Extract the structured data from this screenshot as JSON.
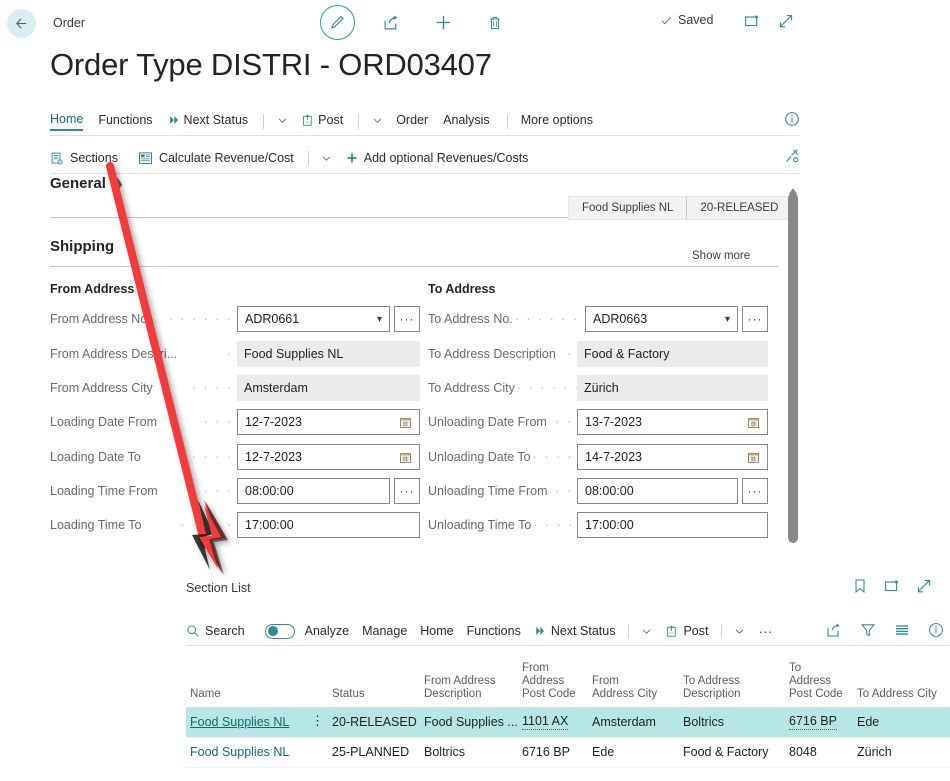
{
  "topbar": {
    "back_icon": "arrow-left-icon",
    "breadcrumb": "Order",
    "actions": [
      {
        "name": "edit-pencil-button",
        "icon": "pencil-icon"
      },
      {
        "name": "share-button",
        "icon": "share-icon"
      },
      {
        "name": "new-button",
        "icon": "plus-icon"
      },
      {
        "name": "delete-button",
        "icon": "trash-icon"
      }
    ],
    "saved_label": "Saved",
    "open-new-window-icon": "open-in-new-window-icon",
    "expand-icon": "expand-diagonal-icon"
  },
  "page_title": "Order Type DISTRI - ORD03407",
  "ribbon": {
    "items": [
      {
        "label": "Home",
        "active": true,
        "icon": null
      },
      {
        "label": "Functions",
        "active": false,
        "icon": null
      },
      {
        "label": "Next Status",
        "active": false,
        "icon": "double-chevron-right-icon"
      },
      {
        "label": "",
        "active": false,
        "icon": "chevron-down-icon"
      },
      {
        "label": "Post",
        "active": false,
        "icon": "post-document-icon"
      },
      {
        "label": "",
        "active": false,
        "icon": "chevron-down-icon"
      },
      {
        "label": "Order",
        "active": false,
        "icon": null
      },
      {
        "label": "Analysis",
        "active": false,
        "icon": null
      },
      {
        "label": "More options",
        "active": false,
        "icon": null
      }
    ],
    "info_icon": "info-circle-icon"
  },
  "actionbar": {
    "items": [
      {
        "label": "Sections",
        "icon": "sections-document-icon"
      },
      {
        "label": "Calculate Revenue/Cost",
        "icon": "calculate-document-icon"
      },
      {
        "label": "",
        "icon": "chevron-down-icon"
      },
      {
        "label": "Add optional Revenues/Costs",
        "icon": "plus-icon"
      }
    ],
    "pin_icon": "pin-unpin-icon"
  },
  "general": {
    "title": "General",
    "collapse_icon": "chevron-right-icon",
    "badges": [
      "Food Supplies NL",
      "20-RELEASED"
    ]
  },
  "shipping": {
    "title": "Shipping",
    "show_more": "Show more",
    "from_address": {
      "title": "From Address",
      "fields": [
        {
          "label": "From Address No.",
          "value": "ADR0661",
          "type": "dropdown-lookup"
        },
        {
          "label": "From Address Descri...",
          "value": "Food Supplies NL",
          "type": "readonly"
        },
        {
          "label": "From Address City",
          "value": "Amsterdam",
          "type": "readonly"
        },
        {
          "label": "Loading Date From",
          "value": "12-7-2023",
          "type": "date"
        },
        {
          "label": "Loading Date To",
          "value": "12-7-2023",
          "type": "date"
        },
        {
          "label": "Loading Time From",
          "value": "08:00:00",
          "type": "lookup"
        },
        {
          "label": "Loading Time To",
          "value": "17:00:00",
          "type": "text"
        }
      ]
    },
    "to_address": {
      "title": "To Address",
      "fields": [
        {
          "label": "To Address No.",
          "value": "ADR0663",
          "type": "dropdown-lookup"
        },
        {
          "label": "To Address Description",
          "value": "Food & Factory",
          "type": "readonly"
        },
        {
          "label": "To Address City",
          "value": "Zürich",
          "type": "readonly"
        },
        {
          "label": "Unloading Date From",
          "value": "13-7-2023",
          "type": "date"
        },
        {
          "label": "Unloading Date To",
          "value": "14-7-2023",
          "type": "date"
        },
        {
          "label": "Unloading Time From",
          "value": "08:00:00",
          "type": "lookup"
        },
        {
          "label": "Unloading Time To",
          "value": "17:00:00",
          "type": "text"
        }
      ]
    }
  },
  "section_list": {
    "title": "Section List",
    "header_icons": [
      "bookmark-icon",
      "open-in-new-window-icon",
      "expand-diagonal-icon"
    ],
    "toolbar": {
      "search_label": "Search",
      "search_icon": "search-icon",
      "analyze_label": "Analyze",
      "analyze_toggle": "toggle-on",
      "items": [
        {
          "label": "Manage",
          "icon": null
        },
        {
          "label": "Home",
          "icon": null
        },
        {
          "label": "Functions",
          "icon": null
        },
        {
          "label": "Next Status",
          "icon": "double-chevron-right-icon"
        },
        {
          "label": "",
          "icon": "chevron-down-icon"
        },
        {
          "label": "Post",
          "icon": "post-document-icon"
        },
        {
          "label": "",
          "icon": "chevron-down-icon"
        },
        {
          "label": "",
          "icon": "ellipsis-icon"
        }
      ],
      "right_icons": [
        "share-icon",
        "filter-funnel-icon",
        "list-lines-icon",
        "info-circle-icon"
      ]
    },
    "columns": [
      "Name",
      "Status",
      "From Address\nDescription",
      "From\nAddress\nPost Code",
      "From\nAddress City",
      "To Address\nDescription",
      "To\nAddress\nPost Code",
      "To Address City"
    ],
    "rows": [
      {
        "selected": true,
        "name": "Food Supplies NL",
        "kebab": "⋮",
        "status": "20-RELEASED",
        "from_address_description": "Food Supplies ...",
        "from_address_post_code": "1101 AX",
        "from_address_city": "Amsterdam",
        "to_address_description": "Boltrics",
        "to_address_post_code": "6716 BP",
        "to_address_city": "Ede"
      },
      {
        "selected": false,
        "name": "Food Supplies NL",
        "kebab": "",
        "status": "25-PLANNED",
        "from_address_description": "Boltrics",
        "from_address_post_code": "6716 BP",
        "from_address_city": "Ede",
        "to_address_description": "Food & Factory",
        "to_address_post_code": "8048",
        "to_address_city": "Zürich"
      }
    ]
  },
  "annotation": {
    "type": "red-arrow",
    "color": "#f23b3b",
    "from": "Sections button",
    "to": "Section List"
  },
  "colors": {
    "accent": "#2b8c92",
    "selection": "#b6e7e4",
    "link": "#0f6c6f",
    "readonly_field": "#edebe9",
    "annotation_red": "#f23b3b"
  }
}
